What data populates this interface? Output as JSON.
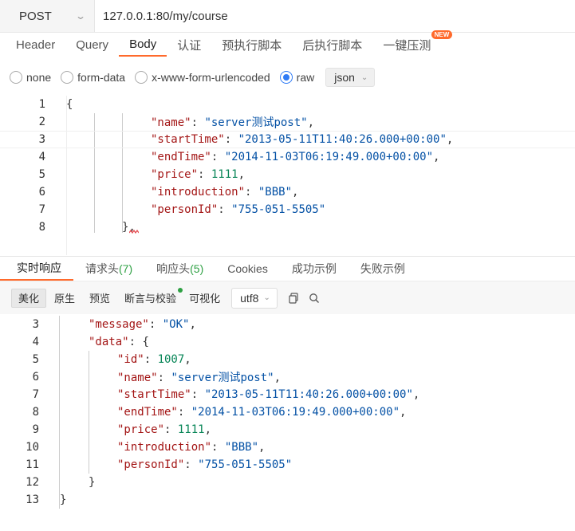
{
  "request": {
    "method": "POST",
    "url": "127.0.0.1:80/my/course",
    "tabs": [
      {
        "label": "Header"
      },
      {
        "label": "Query"
      },
      {
        "label": "Body"
      },
      {
        "label": "认证"
      },
      {
        "label": "预执行脚本"
      },
      {
        "label": "后执行脚本"
      },
      {
        "label": "一键压测"
      }
    ],
    "new_badge": "NEW",
    "body_types": [
      "none",
      "form-data",
      "x-www-form-urlencoded",
      "raw"
    ],
    "selected_body_type": "raw",
    "format": "json"
  },
  "request_body": {
    "line_numbers": [
      "1",
      "2",
      "3",
      "4",
      "5",
      "6",
      "7",
      "8"
    ],
    "open_brace": "{",
    "close_brace": "},",
    "fields": [
      {
        "key": "\"name\"",
        "value": "\"server测试post\"",
        "trail": ","
      },
      {
        "key": "\"startTime\"",
        "value": "\"2013-05-11T11:40:26.000+00:00\"",
        "trail": ","
      },
      {
        "key": "\"endTime\"",
        "value": "\"2014-11-03T06:19:49.000+00:00\"",
        "trail": ","
      },
      {
        "key": "\"price\"",
        "value": "1111",
        "trail": ","
      },
      {
        "key": "\"introduction\"",
        "value": "\"BBB\"",
        "trail": ","
      },
      {
        "key": "\"personId\"",
        "value": "\"755-051-5505\"",
        "trail": ""
      }
    ]
  },
  "response": {
    "tabs": [
      {
        "label": "实时响应",
        "count": ""
      },
      {
        "label": "请求头",
        "count": "(7)"
      },
      {
        "label": "响应头",
        "count": "(5)"
      },
      {
        "label": "Cookies",
        "count": ""
      },
      {
        "label": "成功示例",
        "count": ""
      },
      {
        "label": "失败示例",
        "count": ""
      }
    ],
    "view_buttons": [
      "美化",
      "原生",
      "预览",
      "断言与校验",
      "可视化"
    ],
    "encoding": "utf8",
    "line_numbers": [
      "3",
      "4",
      "5",
      "6",
      "7",
      "8",
      "9",
      "10",
      "11",
      "12",
      "13"
    ],
    "message_key": "\"message\"",
    "message_value": "\"OK\"",
    "data_key": "\"data\"",
    "data_open": "{",
    "data_close": "}",
    "root_close": "}",
    "fields": [
      {
        "key": "\"id\"",
        "value": "1007",
        "trail": ","
      },
      {
        "key": "\"name\"",
        "value": "\"server测试post\"",
        "trail": ","
      },
      {
        "key": "\"startTime\"",
        "value": "\"2013-05-11T11:40:26.000+00:00\"",
        "trail": ","
      },
      {
        "key": "\"endTime\"",
        "value": "\"2014-11-03T06:19:49.000+00:00\"",
        "trail": ","
      },
      {
        "key": "\"price\"",
        "value": "1111",
        "trail": ","
      },
      {
        "key": "\"introduction\"",
        "value": "\"BBB\"",
        "trail": ","
      },
      {
        "key": "\"personId\"",
        "value": "\"755-051-5505\"",
        "trail": ""
      }
    ]
  },
  "colors": {
    "accent": "#ff6a2c",
    "radio_checked": "#2f7bf5",
    "count_green": "#2ea043",
    "json_key": "#a31515",
    "json_string": "#0451a5",
    "json_number": "#098658"
  },
  "icons": [
    "chevron-down-icon",
    "copy-icon",
    "search-icon",
    "squiggle-error-icon"
  ]
}
